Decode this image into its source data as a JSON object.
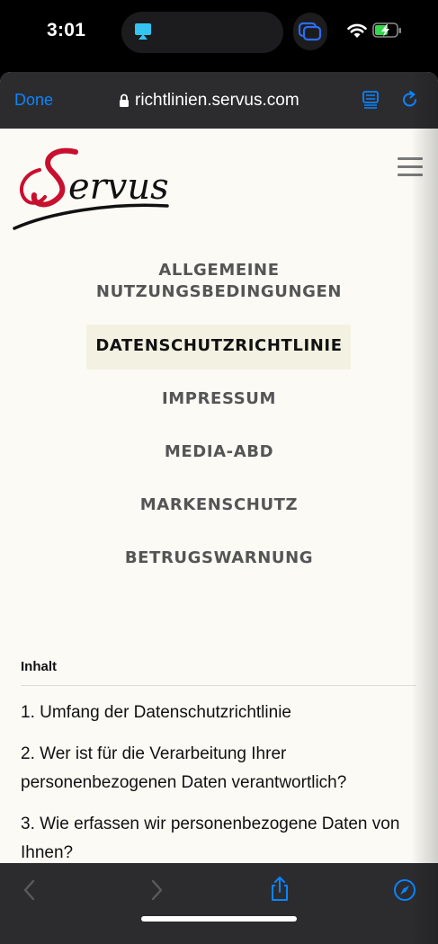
{
  "status": {
    "time": "3:01"
  },
  "browser": {
    "done_label": "Done",
    "url": "richtlinien.servus.com"
  },
  "page": {
    "logo_text": "Servus",
    "menu": [
      "ALLGEMEINE NUTZUNGSBEDINGUNGEN",
      "DATENSCHUTZRICHTLINIE",
      "IMPRESSUM",
      "MEDIA-ABD",
      "MARKENSCHUTZ",
      "BETRUGSWARNUNG"
    ],
    "menu_line1": "ALLGEMEINE",
    "menu_line2": "NUTZUNGSBEDINGUNGEN",
    "active_item": "DATENSCHUTZRICHTLINIE",
    "content_heading": "Inhalt",
    "toc": [
      "1. Umfang der Datenschutzrichtlinie",
      "2. Wer ist für die Verarbeitung Ihrer personenbezogenen Daten verantwortlich?",
      "3. Wie erfassen wir personenbezogene Daten von Ihnen?"
    ]
  },
  "colors": {
    "accent": "#0a84ff",
    "logo_red": "#c8102e",
    "page_bg": "#fbfaf5",
    "bar_bg": "#2c2c2e"
  },
  "icons": [
    "airplay-icon",
    "tabs-icon",
    "wifi-icon",
    "battery-charging-icon",
    "lock-icon",
    "reader-icon",
    "reload-icon",
    "hamburger-menu-icon",
    "back-icon",
    "forward-icon",
    "share-icon",
    "compass-icon"
  ]
}
